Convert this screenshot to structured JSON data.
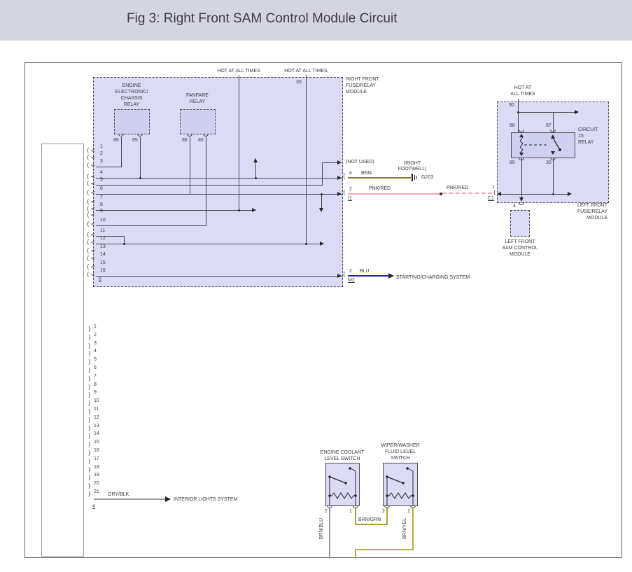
{
  "title_bar": {
    "title": "Fig 3: Right Front SAM Control Module Circuit"
  },
  "main_module": {
    "hot_left": "HOT AT ALL TIMES",
    "hot_right": "HOT AT ALL TIMES",
    "pin30": "30",
    "name1": "RIGHT FRONT",
    "name2": "FUSE/RELAY",
    "name3": "MODULE",
    "engine_relay1": "ENGINE",
    "engine_relay2": "ELECTRONIC/",
    "engine_relay3": "CHASSIS",
    "engine_relay4": "RELAY",
    "fanfare1": "FANFARE",
    "fanfare2": "RELAY",
    "eng86": "86",
    "eng85": "85",
    "fan86": "86",
    "fan85": "85",
    "not_used": "(NOT USED)",
    "pins": [
      "1",
      "2",
      "3",
      "4",
      "5",
      "6",
      "7",
      "8",
      "9",
      "10",
      "11",
      "12",
      "13",
      "14",
      "15",
      "16"
    ],
    "connector_id": "5"
  },
  "wires": {
    "brn_pin": "4",
    "brn_label": "BRN",
    "footwell1": "(RIGHT",
    "footwell2": "FOOTWELL)",
    "ground": "G203",
    "pnk_pin": "2",
    "pnk_label": "PNK/RED",
    "pnk_conn": "I1",
    "pnk2_label": "PNK/RED",
    "blu_pin": "2",
    "blu_label": "BLU",
    "blu_conn": "M2",
    "blu_dest": "STARTING/CHARGING SYSTEM",
    "gry_label": "GRY/BLK",
    "gry_dest": "INTERIOR LIGHTS SYSTEM"
  },
  "right_module": {
    "hot1": "HOT AT",
    "hot2": "ALL TIMES",
    "pin30_top": "30",
    "p86": "86",
    "p87": "87",
    "p85": "85",
    "p30": "30",
    "relay1": "CIRCUIT",
    "relay2": "15",
    "relay3": "RELAY",
    "pin4": "4",
    "pin1": "1",
    "conn_c1": "C1",
    "name1": "LEFT FRONT",
    "name2": "FUSE/RELAY",
    "name3": "MODULE"
  },
  "sam_module": {
    "name1": "LEFT FRONT",
    "name2": "SAM CONTROL",
    "name3": "MODULE"
  },
  "left_connector": {
    "pins": [
      "1",
      "2",
      "3",
      "4",
      "5",
      "6",
      "7",
      "8",
      "9",
      "10",
      "11",
      "12",
      "13",
      "14",
      "15",
      "16",
      "17",
      "18",
      "19",
      "20",
      "21"
    ],
    "connector_id": "4"
  },
  "switches": {
    "ecl_name1": "ENGINE COOLANT",
    "ecl_name2": "LEVEL SWITCH",
    "ww_name1": "WIPER/WASHER",
    "ww_name2": "FLUID LEVEL",
    "ww_name3": "SWITCH",
    "ecl_pin2": "2",
    "ecl_pin1": "1",
    "ww_pin2": "2",
    "ww_pin1": "1",
    "brnblu": "BRN/BLU",
    "brngrn": "BRN/GRN",
    "brnyel": "BRN/YEL"
  },
  "colors": {
    "titlebar_bg": "#d5d4e1",
    "module_fill": "#dbdbf6",
    "relay_fill": "#cfcff0",
    "wire": "#45454e",
    "brn": "#8b7536",
    "pnk_red": "#f2a6b2",
    "blu": "#2222cc",
    "gry_blk": "#9b9ba1",
    "brn_grn": "#aaa23a",
    "brn_yel": "#b5ad3a",
    "brn_blu": "#9298a6"
  }
}
